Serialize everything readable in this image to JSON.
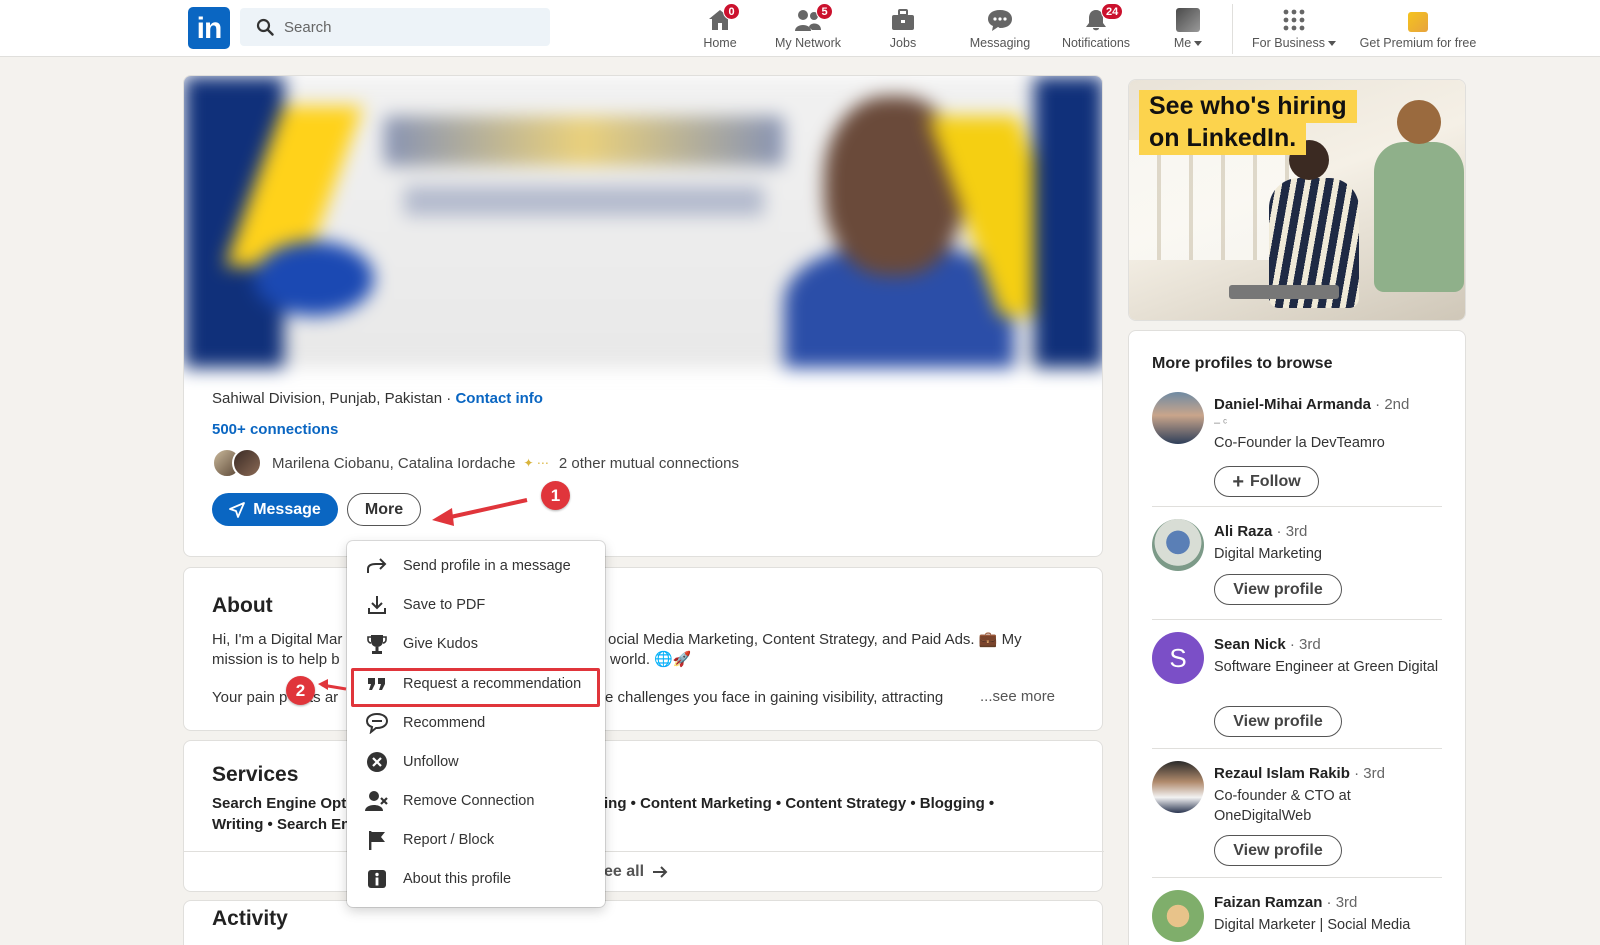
{
  "nav": {
    "search_placeholder": "Search",
    "items": [
      {
        "label": "Home",
        "badge": "",
        "icon": "home-icon"
      },
      {
        "label": "My Network",
        "badge": "5",
        "icon": "people-icon"
      },
      {
        "label": "Jobs",
        "badge": "",
        "icon": "briefcase-icon"
      },
      {
        "label": "Messaging",
        "badge": "",
        "icon": "chat-icon"
      },
      {
        "label": "Notifications",
        "badge": "24",
        "icon": "bell-icon"
      },
      {
        "label": "Me",
        "badge": "",
        "icon": "avatar-icon"
      },
      {
        "label": "For Business",
        "badge": "",
        "icon": "grid-icon"
      },
      {
        "label": "Get Premium for free",
        "badge": "",
        "icon": "premium-icon"
      }
    ],
    "home_dot": "0"
  },
  "profile": {
    "location": "Sahiwal Division, Punjab, Pakistan",
    "separator": "·",
    "contact_info": "Contact info",
    "connections": "500+ connections",
    "mutual_names": "Marilena Ciobanu, Catalina Iordache",
    "mutual_other": "2 other mutual connections",
    "message_button": "Message",
    "more_button": "More"
  },
  "about": {
    "title": "About",
    "line1_left": "Hi, I'm a Digital Mar",
    "line1_right": "ocial Media Marketing, Content Strategy, and Paid Ads. 💼  My",
    "line2_left": "mission is to help b",
    "line2_right": "world. 🌐🚀",
    "line3_left": "Your pain p",
    "line3_mid": "ts ar",
    "line3_right": "e challenges you face in gaining visibility, attracting",
    "see_more": "...see more"
  },
  "services": {
    "title": "Services",
    "line1_left": "Search Engine Opti",
    "line1_right": "ing • Content Marketing • Content Strategy • Blogging •",
    "line2_left": "Writing • Search En",
    "see_all": "ee all"
  },
  "activity": {
    "title": "Activity"
  },
  "dropdown": {
    "items": [
      {
        "label": "Send profile in a message",
        "icon": "share-arrow-icon"
      },
      {
        "label": "Save to PDF",
        "icon": "download-icon"
      },
      {
        "label": "Give Kudos",
        "icon": "trophy-icon"
      },
      {
        "label": "Request a recommendation",
        "icon": "quote-icon"
      },
      {
        "label": "Recommend",
        "icon": "speech-bubble-icon"
      },
      {
        "label": "Unfollow",
        "icon": "x-circle-icon"
      },
      {
        "label": "Remove Connection",
        "icon": "remove-person-icon"
      },
      {
        "label": "Report / Block",
        "icon": "flag-icon"
      },
      {
        "label": "About this profile",
        "icon": "info-icon"
      }
    ],
    "highlighted_index": 3
  },
  "annotations": {
    "step1": "1",
    "step2": "2",
    "color": "#e0353b"
  },
  "ad": {
    "line1": "See who's hiring",
    "line2": "on LinkedIn."
  },
  "browse": {
    "title": "More profiles to browse",
    "people": [
      {
        "name": "Daniel-Mihai Armanda",
        "degree": "· 2nd",
        "sub": "– ᶜ",
        "headline": "Co-Founder la DevTeamro",
        "button": "Follow"
      },
      {
        "name": "Ali Raza",
        "degree": "· 3rd",
        "headline": "Digital Marketing",
        "button": "View profile"
      },
      {
        "name": "Sean Nick",
        "degree": "· 3rd",
        "headline": "Software Engineer at Green Digital",
        "button": "View profile",
        "initial": "S"
      },
      {
        "name": "Rezaul Islam Rakib",
        "degree": "· 3rd",
        "headline": "Co-founder & CTO at OneDigitalWeb",
        "button": "View profile"
      },
      {
        "name": "Faizan Ramzan",
        "degree": "· 3rd",
        "headline": "Digital Marketer | Social Media",
        "button": ""
      }
    ]
  },
  "colors": {
    "brand": "#0a66c2",
    "badge": "#cb112d",
    "annotation": "#e0353b",
    "ad_highlight": "#fcd34d"
  }
}
